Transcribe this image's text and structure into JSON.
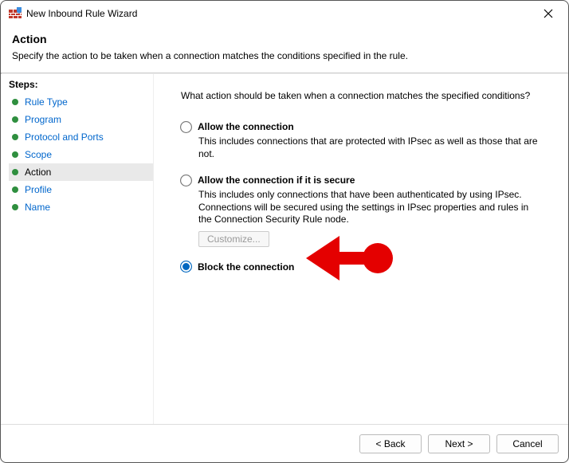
{
  "window": {
    "title": "New Inbound Rule Wizard"
  },
  "header": {
    "title": "Action",
    "subtitle": "Specify the action to be taken when a connection matches the conditions specified in the rule."
  },
  "steps": {
    "title": "Steps:",
    "items": [
      {
        "label": "Rule Type",
        "active": false
      },
      {
        "label": "Program",
        "active": false
      },
      {
        "label": "Protocol and Ports",
        "active": false
      },
      {
        "label": "Scope",
        "active": false
      },
      {
        "label": "Action",
        "active": true
      },
      {
        "label": "Profile",
        "active": false
      },
      {
        "label": "Name",
        "active": false
      }
    ]
  },
  "content": {
    "prompt": "What action should be taken when a connection matches the specified conditions?",
    "options": [
      {
        "id": "allow",
        "title": "Allow the connection",
        "desc": "This includes connections that are protected with IPsec as well as those that are not.",
        "selected": false
      },
      {
        "id": "allow-secure",
        "title": "Allow the connection if it is secure",
        "desc": "This includes only connections that have been authenticated by using IPsec. Connections will be secured using the settings in IPsec properties and rules in the Connection Security Rule node.",
        "selected": false,
        "customize_label": "Customize..."
      },
      {
        "id": "block",
        "title": "Block the connection",
        "desc": "",
        "selected": true
      }
    ]
  },
  "footer": {
    "back": "< Back",
    "next": "Next >",
    "cancel": "Cancel"
  }
}
